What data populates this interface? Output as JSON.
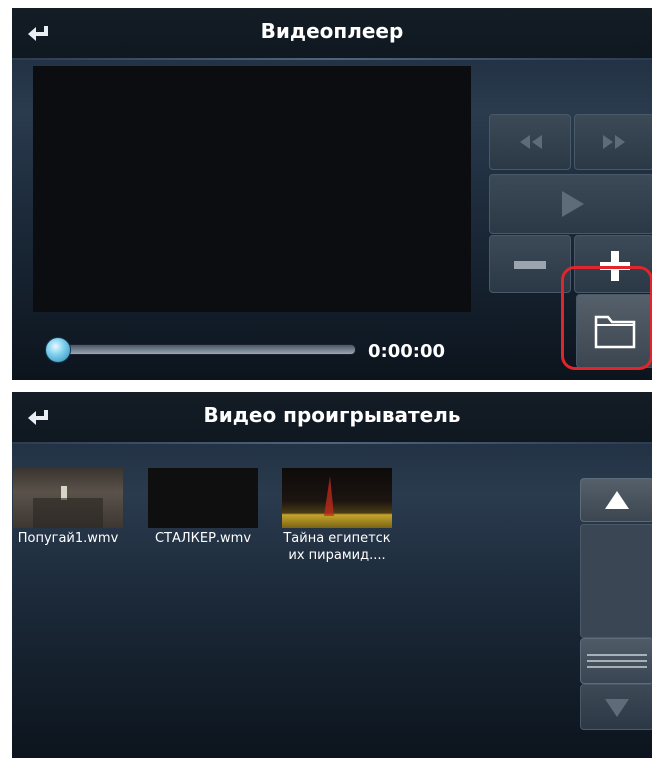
{
  "player": {
    "title": "Видеоплеер",
    "time": "0:00:00",
    "progress": 0,
    "icons": [
      "back-icon",
      "rewind-icon",
      "fast-forward-icon",
      "play-icon",
      "volume-down-icon",
      "volume-up-icon",
      "folder-icon"
    ]
  },
  "browser": {
    "title": "Видео проигрыватель",
    "files": [
      {
        "name": "Попугай1.wmv",
        "icon": "video-thumbnail"
      },
      {
        "name": "СТАЛКЕР.wmv",
        "icon": "video-thumbnail"
      },
      {
        "name_line1": "Тайна египетск",
        "name_line2": "их пирамид....",
        "icon": "video-thumbnail"
      }
    ],
    "icons": [
      "back-icon",
      "scroll-up-icon",
      "scroll-down-icon"
    ]
  },
  "colors": {
    "highlight": "#e2242c",
    "accent": "#7fd0ee"
  }
}
